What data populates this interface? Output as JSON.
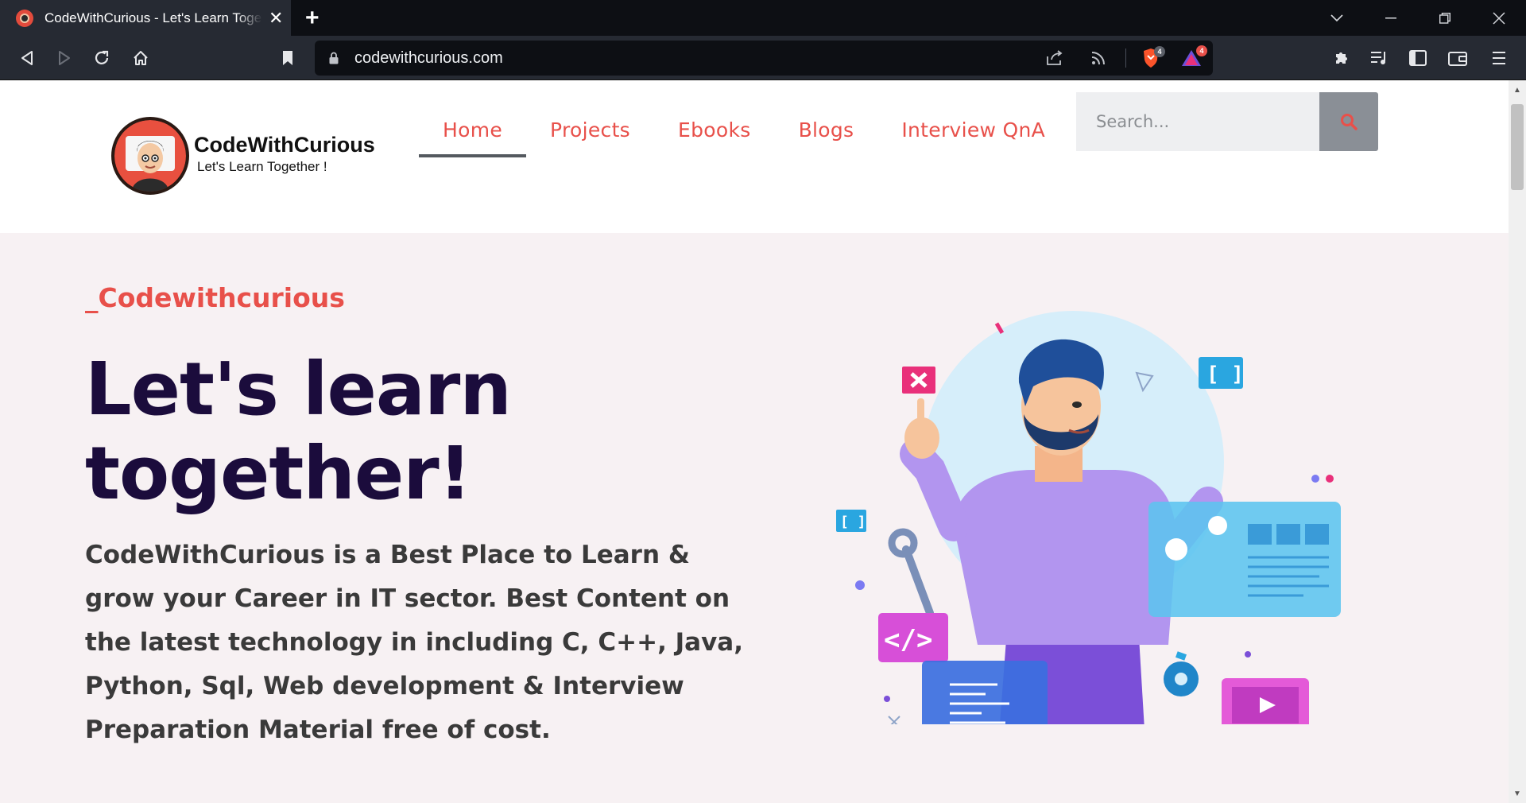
{
  "browser": {
    "tab_title": "CodeWithCurious - Let's Learn Together !",
    "url": "codewithcurious.com",
    "shields_count": "4",
    "rewards_count": "4"
  },
  "site": {
    "logo_name": "CodeWithCurious",
    "logo_tagline": "Let's Learn Together !",
    "nav": [
      {
        "label": "Home"
      },
      {
        "label": "Projects"
      },
      {
        "label": "Ebooks"
      },
      {
        "label": "Blogs"
      },
      {
        "label": "Interview QnA"
      }
    ],
    "search_placeholder": "Search..."
  },
  "hero": {
    "subtitle": "_Codewithcurious",
    "title_line1": "Let's learn",
    "title_line2": "together!",
    "description": "CodeWithCurious is a Best Place to Learn & grow your Career in IT sector. Best Content on the latest technology in including C, C++, Java, Python, Sql, Web development & Interview Preparation Material free of cost."
  },
  "colors": {
    "accent": "#e8504a",
    "title": "#1b0c3c",
    "page_bg": "#f7f1f3",
    "chrome_bg": "#262a33"
  }
}
